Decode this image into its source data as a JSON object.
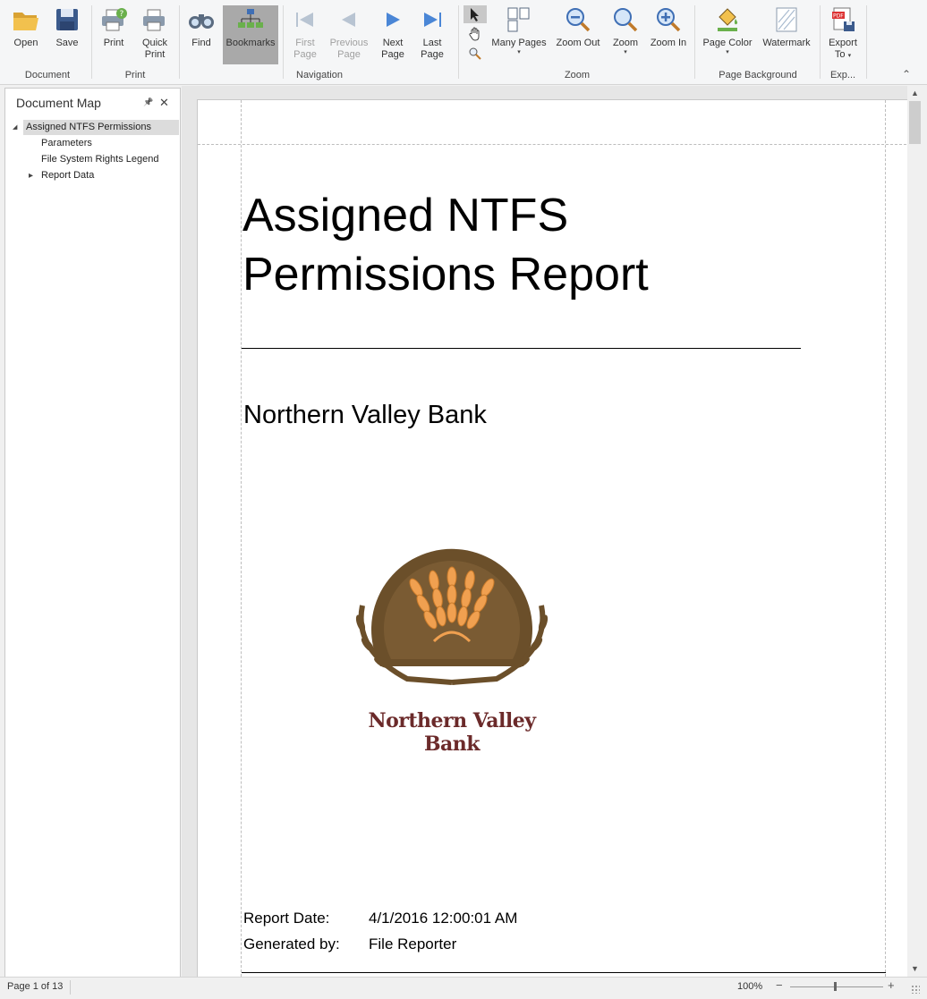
{
  "toolbar": {
    "document": {
      "open": "Open",
      "save": "Save",
      "group": "Document"
    },
    "print": {
      "print": "Print",
      "quick_print_1": "Quick",
      "quick_print_2": "Print",
      "group": "Print"
    },
    "navigation": {
      "find": "Find",
      "bookmarks": "Bookmarks",
      "first_1": "First",
      "first_2": "Page",
      "previous_1": "Previous",
      "previous_2": "Page",
      "next_1": "Next",
      "next_2": "Page",
      "last_1": "Last",
      "last_2": "Page",
      "group": "Navigation"
    },
    "zoom": {
      "many_pages": "Many Pages",
      "zoom_out": "Zoom Out",
      "zoom": "Zoom",
      "zoom_in": "Zoom In",
      "group": "Zoom"
    },
    "page_background": {
      "page_color": "Page Color",
      "watermark": "Watermark",
      "group": "Page Background"
    },
    "export": {
      "export_1": "Export",
      "export_2": "To",
      "group": "Exp..."
    },
    "dropdown_caret": "▾",
    "collapse_caret": "⌃"
  },
  "document_map": {
    "title": "Document Map",
    "pin_glyph": "📌",
    "close_glyph": "✕",
    "items": [
      {
        "label": "Assigned NTFS Permissions",
        "expander": "◢",
        "selected": true
      },
      {
        "label": "Parameters"
      },
      {
        "label": "File System Rights Legend"
      },
      {
        "label": "Report Data",
        "expander": "▸"
      }
    ]
  },
  "report": {
    "title_line1": "Assigned NTFS",
    "title_line2": "Permissions Report",
    "company": "Northern Valley Bank",
    "logo_text": "Northern Valley Bank",
    "report_date_label": "Report Date:",
    "report_date_value": "4/1/2016 12:00:01 AM",
    "generated_by_label": "Generated by:",
    "generated_by_value": "File Reporter"
  },
  "status_bar": {
    "page_info": "Page 1 of 13",
    "zoom_level": "100%",
    "zoom_minus": "−",
    "zoom_plus": "+"
  },
  "colors": {
    "active_button": "#a9a9a9",
    "selected_tree_item": "#dcdcdc",
    "logo_brown": "#6b4f2a",
    "logo_text": "#6b2a2a",
    "wheat": "#f0a050"
  }
}
